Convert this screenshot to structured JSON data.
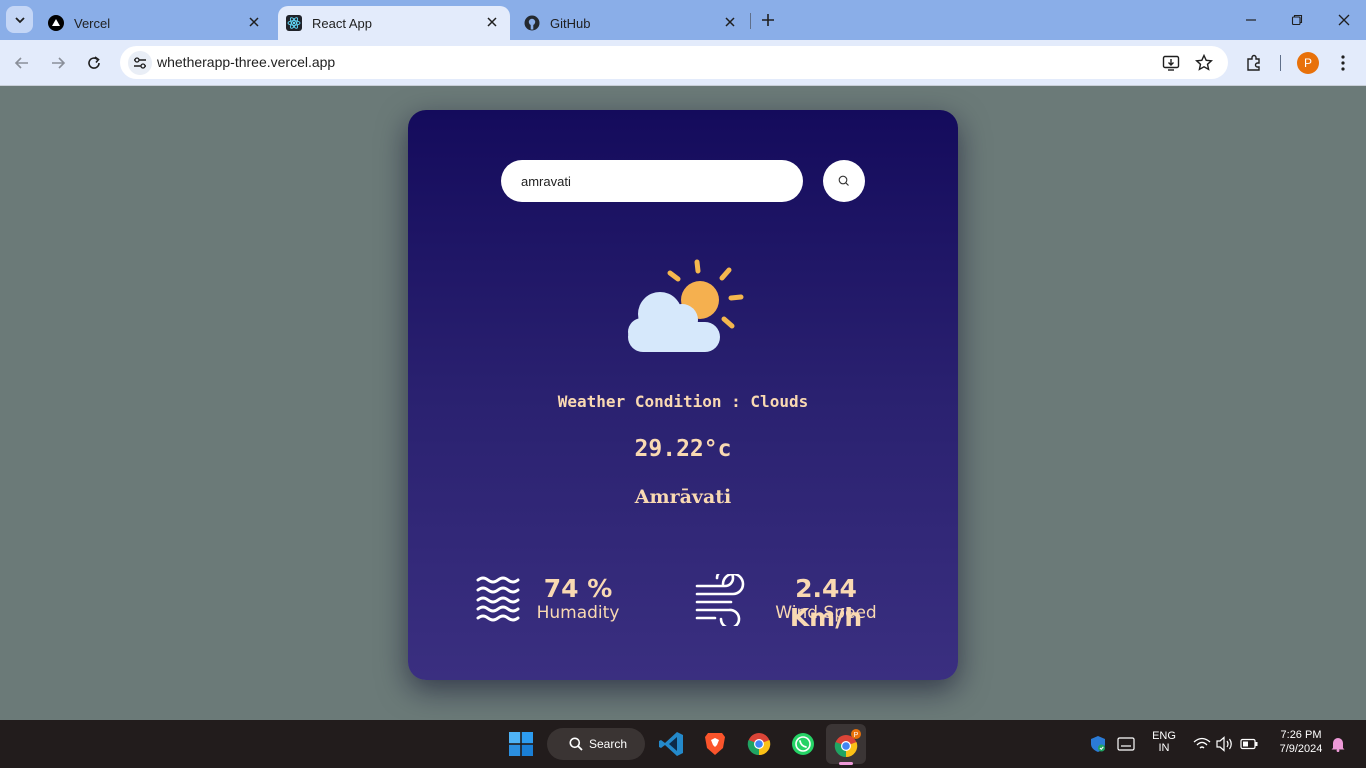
{
  "browser": {
    "tabs": [
      {
        "title": "Vercel",
        "favicon": "vercel-icon",
        "active": false
      },
      {
        "title": "React App",
        "favicon": "react-icon",
        "active": true
      },
      {
        "title": "GitHub",
        "favicon": "github-icon",
        "active": false
      }
    ],
    "url": "whetherapp-three.vercel.app",
    "profile_initial": "P"
  },
  "app": {
    "search": {
      "value": "amravati",
      "placeholder": ""
    },
    "weather_icon": "sun-behind-cloud-icon",
    "condition_text": "Weather Condition : Clouds",
    "temperature": "29.22°c",
    "city": "Amrāvati",
    "humidity": {
      "value": "74 %",
      "label": "Humadity",
      "icon": "waves-icon"
    },
    "wind": {
      "value": "2.44 Km/h",
      "label": "Wind Speed",
      "icon": "wind-icon"
    },
    "colors": {
      "card_top": "#140b5c",
      "card_bottom": "#3a2f80",
      "text": "#f9d9b2",
      "page_bg": "#6b7a78"
    }
  },
  "taskbar": {
    "search_label": "Search",
    "apps": [
      "start-icon",
      "vscode-icon",
      "brave-icon",
      "chrome-icon",
      "whatsapp-icon",
      "chrome-profile-icon"
    ],
    "language": {
      "line1": "ENG",
      "line2": "IN"
    },
    "time": "7:26 PM",
    "date": "7/9/2024"
  }
}
